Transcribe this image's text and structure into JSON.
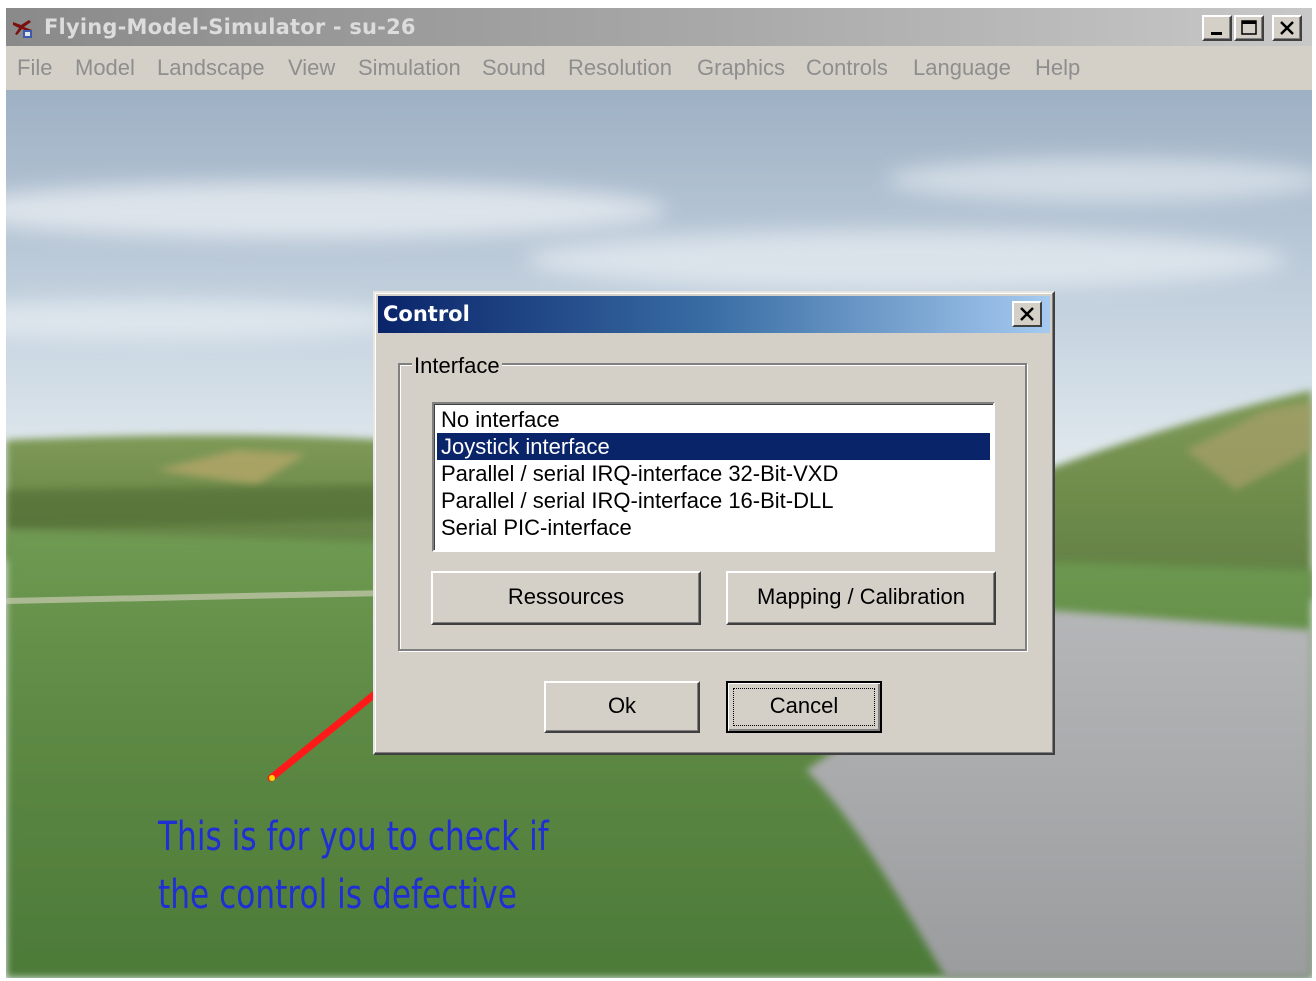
{
  "window": {
    "title": "Flying-Model-Simulator - su-26",
    "app_icon": "airplane-icon",
    "controls": [
      "minimize-icon",
      "maximize-icon",
      "close-icon"
    ]
  },
  "menu": [
    "File",
    "Model",
    "Landscape",
    "View",
    "Simulation",
    "Sound",
    "Resolution",
    "Graphics",
    "Controls",
    "Language",
    "Help"
  ],
  "dialog": {
    "title": "Control",
    "close_icon": "close-icon",
    "group_label": "Interface",
    "interfaces": [
      {
        "label": "No interface",
        "selected": false
      },
      {
        "label": "Joystick interface",
        "selected": true
      },
      {
        "label": "Parallel / serial IRQ-interface 32-Bit-VXD",
        "selected": false
      },
      {
        "label": "Parallel / serial IRQ-interface 16-Bit-DLL",
        "selected": false
      },
      {
        "label": "Serial PIC-interface",
        "selected": false
      }
    ],
    "ressources_button": "Ressources",
    "mapping_button": "Mapping / Calibration",
    "ok_button": "Ok",
    "cancel_button": "Cancel"
  },
  "annotation": {
    "line1": "This is for you to check if",
    "line2": "the control is defective",
    "arrow_color": "#ff1a1a",
    "text_color": "#1f2fd6"
  },
  "colors": {
    "selection": "#0a246a",
    "dialog_face": "#d4d0c8"
  }
}
